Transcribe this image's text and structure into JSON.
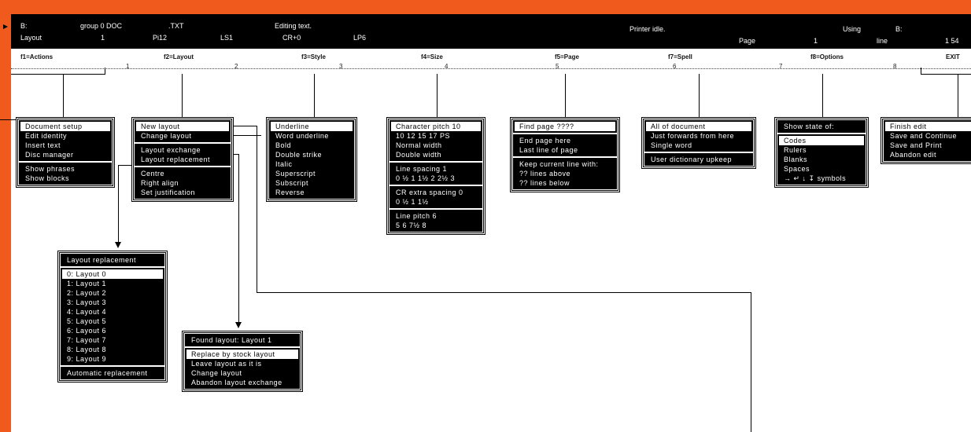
{
  "status": {
    "drive": "B:",
    "group": "group  0 DOC",
    "ext": ".TXT",
    "mode": "Editing text.",
    "printer": "Printer idle.",
    "using_label": "Using",
    "using_drive": "B:",
    "layout_label": "Layout",
    "layout_num": "1",
    "pitch": "Pi12",
    "ls": "LS1",
    "cr": "CR+0",
    "lp": "LP6",
    "page_label": "Page",
    "page_num": "1",
    "line_label": "line",
    "line_num": "1 54"
  },
  "function_keys": [
    "f1=Actions",
    "f2=Layout",
    "f3=Style",
    "f4=Size",
    "f5=Page",
    "f7=Spell",
    "f8=Options",
    "EXIT"
  ],
  "ruler_numbers": [
    "1",
    "2",
    "3",
    "4",
    "5",
    "6",
    "7",
    "8"
  ],
  "menus": {
    "actions": [
      [
        "Document  setup",
        "Edit  identity",
        "Insert  text",
        "Disc  manager"
      ],
      [
        "Show  phrases",
        "Show  blocks"
      ]
    ],
    "layout": [
      [
        "New  layout",
        "Change  layout"
      ],
      [
        "Layout  exchange",
        "Layout  replacement"
      ],
      [
        "Centre",
        "Right  align",
        "Set  justification"
      ]
    ],
    "style": [
      [
        "Underline",
        "Word  underline",
        "Bold",
        "Double  strike",
        "Italic",
        "Superscript",
        "Subscript",
        "Reverse"
      ]
    ],
    "size": [
      [
        "Character  pitch     10",
        "10    12   15   17  PS",
        "Normal  width",
        "Double  width"
      ],
      [
        "Line  spacing          1",
        "0   ½    1  1½  2  2½  3"
      ],
      [
        "CR  extra  spacing   0",
        "0     ½      1      1½"
      ],
      [
        "Line  pitch              6",
        "5       6      7½    8"
      ]
    ],
    "page": [
      [
        "Find  page          ????"
      ],
      [
        "End  page  here",
        "Last  line  of  page"
      ],
      [
        "Keep  current  line  with:",
        "??  lines  above",
        "??  lines  below"
      ]
    ],
    "spell": [
      [
        "All  of  document",
        "Just  forwards  from  here",
        "Single  word"
      ],
      [
        "User  dictionary  upkeep"
      ]
    ],
    "options": [
      [
        "Show  state  of:"
      ],
      [
        "Codes",
        "Rulers",
        "Blanks",
        "Spaces",
        "→ ↵ ↓ ↧      symbols"
      ]
    ],
    "exit": [
      [
        "Finish  edit",
        "Save  and  Continue",
        "Save  and  Print",
        "Abandon  edit"
      ]
    ],
    "layout_replacement": [
      [
        "Layout  replacement"
      ],
      [
        "0:  Layout   0",
        "1:  Layout   1",
        "2:  Layout   2",
        "3:  Layout   3",
        "4:  Layout   4",
        "5:  Layout   5",
        "6:  Layout   6",
        "7:  Layout   7",
        "8:  Layout   8",
        "9:  Layout   9"
      ],
      [
        "Automatic  replacement"
      ]
    ],
    "layout_exchange": [
      [
        "Found  layout:  Layout       1"
      ],
      [
        "Replace  by  stock  layout",
        "Leave  layout  as  it  is",
        "Change  layout",
        "Abandon  layout  exchange"
      ]
    ]
  },
  "colors": {
    "border": "#f15a1d",
    "menu_bg": "#000000",
    "menu_fg": "#ffffff",
    "screen_bg": "#ffffff"
  }
}
